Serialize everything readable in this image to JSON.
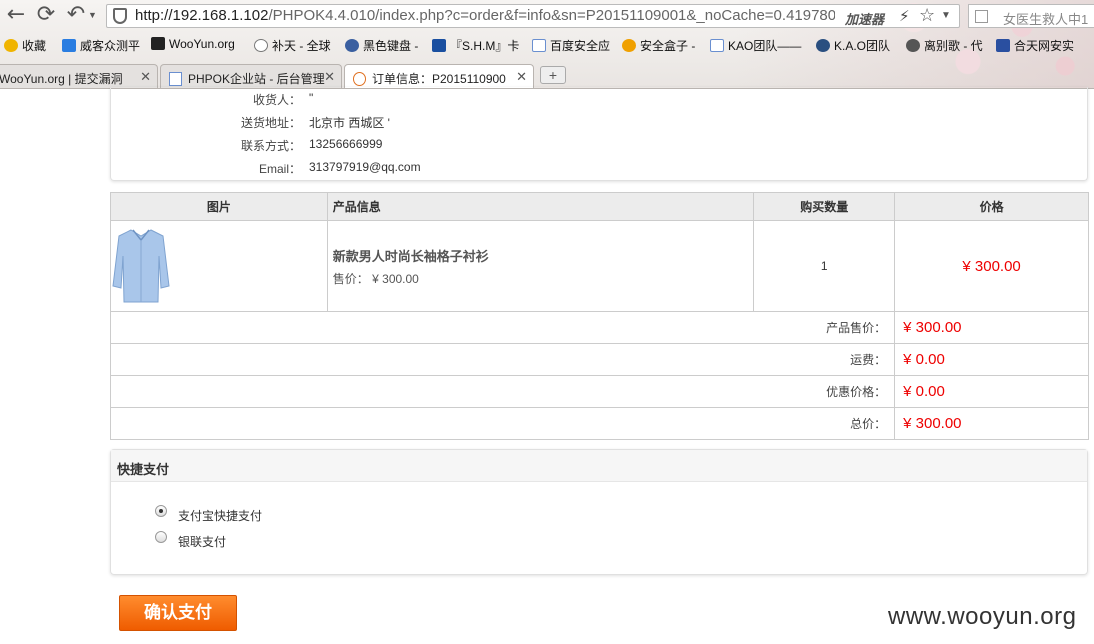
{
  "browser": {
    "url_host": "http://192.168.1.102",
    "url_path": "/PHPOK4.4.010/index.php?c=order&f=info&sn=P20151109001&_noCache=0.419780",
    "accelerator_label": "加速器",
    "search_text": "女医生救人中1",
    "bookmarks": [
      {
        "label": "收藏",
        "color": "#f0b400"
      },
      {
        "label": "威客众测平",
        "color": "#2a7de1"
      },
      {
        "label": "WooYun.org",
        "color": "#222222"
      },
      {
        "label": "补天 - 全球",
        "color": "#777777"
      },
      {
        "label": "黑色键盘 -",
        "color": "#3a5fa0"
      },
      {
        "label": "『S.H.M』卡",
        "color": "#1a4fa0"
      },
      {
        "label": "百度安全应",
        "color": "#6a8fd0"
      },
      {
        "label": "安全盒子 -",
        "color": "#f0a000"
      },
      {
        "label": "KAO团队——",
        "color": "#6a8fd0"
      },
      {
        "label": "K.A.O团队",
        "color": "#2a4f80"
      },
      {
        "label": "离别歌 - 代",
        "color": "#555555"
      },
      {
        "label": "合天网安实",
        "color": "#2a4fa0"
      }
    ],
    "tabs": [
      {
        "label": "WooYun.org | 提交漏洞",
        "active": false
      },
      {
        "label": "PHPOK企业站 - 后台管理",
        "active": false
      },
      {
        "label": "订单信息：P2015110900",
        "active": true
      }
    ],
    "new_tab_label": "+",
    "close_glyph": "✕"
  },
  "order_info": {
    "receiver_label": "收货人：",
    "receiver_value": "\"",
    "address_label": "送货地址：",
    "address_value": "北京市 西城区 '",
    "phone_label": "联系方式：",
    "phone_value": "13256666999",
    "email_label": "Email：",
    "email_value": "313797919@qq.com"
  },
  "product_table": {
    "headers": [
      "图片",
      "产品信息",
      "购买数量",
      "价格"
    ],
    "product_name": "新款男人时尚长袖格子衬衫",
    "product_unit_price": "售价： ¥ 300.00",
    "quantity": "1",
    "price": "¥ 300.00",
    "image_icon": "shirt-image"
  },
  "summary": [
    {
      "label": "产品售价：",
      "value": "¥ 300.00"
    },
    {
      "label": "运费：",
      "value": "¥ 0.00"
    },
    {
      "label": "优惠价格：",
      "value": "¥ 0.00"
    },
    {
      "label": "总价：",
      "value": "¥ 300.00"
    }
  ],
  "payment": {
    "title": "快捷支付",
    "options": [
      {
        "label": "支付宝快捷支付",
        "checked": true
      },
      {
        "label": "银联支付",
        "checked": false
      }
    ]
  },
  "confirm_label": "确认支付",
  "watermark": "www.wooyun.org",
  "colors": {
    "accent": "#ef5c00",
    "price": "#e00000"
  }
}
